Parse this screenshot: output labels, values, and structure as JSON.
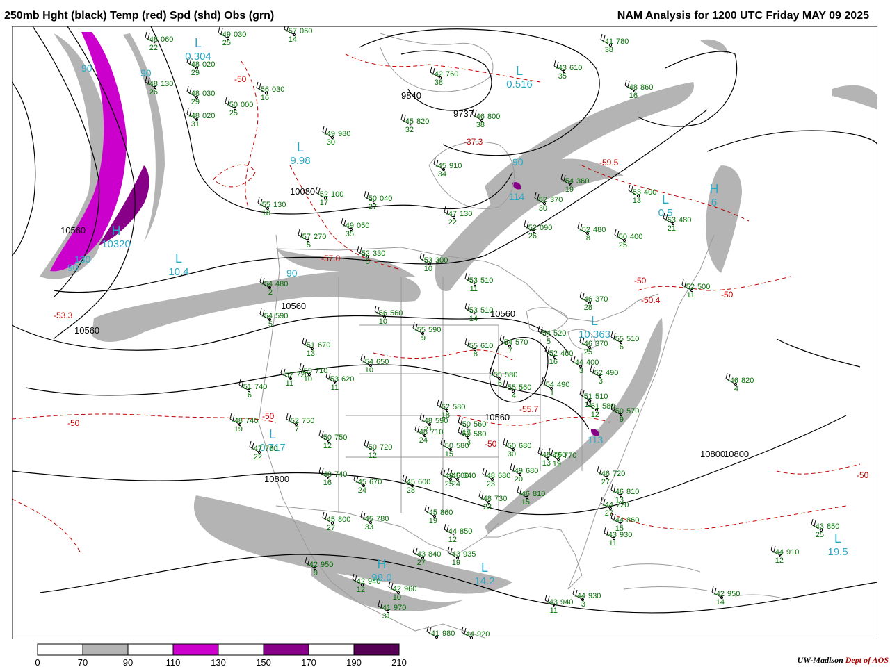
{
  "header": {
    "left": "250mb Hght (black) Temp (red) Spd (shd) Obs (grn)",
    "right": "NAM Analysis for 1200 UTC Friday  MAY 09 2025"
  },
  "colors": {
    "height_contour": "#000000",
    "temp_contour": "#c00000",
    "obs": "#007000",
    "center_label": "#2aa9c6",
    "border": "#9a9a9a",
    "speed_70_90": "#b4b4b4",
    "speed_110_130": "#cc00cc",
    "speed_150_170": "#880088",
    "speed_190_210": "#550055"
  },
  "legend": {
    "ticks": [
      "0",
      "70",
      "90",
      "110",
      "130",
      "150",
      "170",
      "190",
      "210"
    ],
    "bins": [
      {
        "from": 0,
        "to": 70,
        "color": "#ffffff"
      },
      {
        "from": 70,
        "to": 90,
        "color": "#b4b4b4"
      },
      {
        "from": 90,
        "to": 110,
        "color": "#ffffff"
      },
      {
        "from": 110,
        "to": 130,
        "color": "#cc00cc"
      },
      {
        "from": 130,
        "to": 150,
        "color": "#ffffff"
      },
      {
        "from": 150,
        "to": 170,
        "color": "#880088"
      },
      {
        "from": 170,
        "to": 190,
        "color": "#ffffff"
      },
      {
        "from": 190,
        "to": 210,
        "color": "#550055"
      }
    ]
  },
  "credit": {
    "org": "UW-Madison",
    "dept": "Dept of AOS"
  },
  "height_labels": [
    "9840",
    "9737",
    "10080",
    "10560",
    "10560",
    "10560",
    "10560",
    "10560",
    "10800",
    "10800",
    "10800"
  ],
  "centers": [
    {
      "type": "L",
      "value": "0.304"
    },
    {
      "type": "L",
      "value": "0.516"
    },
    {
      "type": "L",
      "value": "9.98"
    },
    {
      "type": "L",
      "value": "10.4"
    },
    {
      "type": "H",
      "value": "10320"
    },
    {
      "type": "L",
      "value": "0.717"
    },
    {
      "type": "H",
      "value": "98.0"
    },
    {
      "type": "L",
      "value": "14.2"
    },
    {
      "type": "L",
      "value": "10.363"
    },
    {
      "type": "L",
      "value": "19.5"
    },
    {
      "type": "H",
      "value": "6"
    },
    {
      "type": "L",
      "value": "0.5"
    }
  ],
  "temp_labels": [
    "-50",
    "-50",
    "-50",
    "-50",
    "-50",
    "-50",
    "-53.3",
    "-57.0",
    "-59.5",
    "-37.3",
    "-55.7",
    "-50",
    "-50.4"
  ],
  "speed_labels": [
    "90",
    "90",
    "90",
    "130",
    "90",
    "90",
    "114",
    "113"
  ],
  "obs": [
    {
      "t": "-48",
      "h": "060",
      "d": "22"
    },
    {
      "t": "-49",
      "h": "030",
      "d": "25"
    },
    {
      "t": "-57",
      "h": "060",
      "d": "14"
    },
    {
      "t": "-48",
      "h": "020",
      "d": "29"
    },
    {
      "t": "-48",
      "h": "130",
      "d": "26"
    },
    {
      "t": "-48",
      "h": "030",
      "d": "29"
    },
    {
      "t": "-56",
      "h": "030",
      "d": "16"
    },
    {
      "t": "-50",
      "h": "000",
      "d": "25"
    },
    {
      "t": "-48",
      "h": "020",
      "d": "31"
    },
    {
      "t": "-49",
      "h": "980",
      "d": "30"
    },
    {
      "t": "-42",
      "h": "760",
      "d": "38"
    },
    {
      "t": "-45",
      "h": "820",
      "d": "32"
    },
    {
      "t": "-46",
      "h": "800",
      "d": "38"
    },
    {
      "t": "-41",
      "h": "780",
      "d": "38"
    },
    {
      "t": "-43",
      "h": "610",
      "d": "35"
    },
    {
      "t": "-48",
      "h": "860",
      "d": "16"
    },
    {
      "t": "-45",
      "h": "910",
      "d": "34"
    },
    {
      "t": "-52",
      "h": "100",
      "d": "17"
    },
    {
      "t": "-50",
      "h": "040",
      "d": "27"
    },
    {
      "t": "-49",
      "h": "050",
      "d": "35"
    },
    {
      "t": "-55",
      "h": "130",
      "d": "18"
    },
    {
      "t": "-52",
      "h": "090",
      "d": "26"
    },
    {
      "t": "-47",
      "h": "130",
      "d": "22"
    },
    {
      "t": "-52",
      "h": "370",
      "d": "30"
    },
    {
      "t": "-54",
      "h": "360",
      "d": "19"
    },
    {
      "t": "-53",
      "h": "400",
      "d": "13"
    },
    {
      "t": "-52",
      "h": "480",
      "d": "8"
    },
    {
      "t": "-57",
      "h": "270",
      "d": "5"
    },
    {
      "t": "-50",
      "h": "400",
      "d": "25"
    },
    {
      "t": "-53",
      "h": "480",
      "d": "21"
    },
    {
      "t": "-52",
      "h": "330",
      "d": "5"
    },
    {
      "t": "-53",
      "h": "300",
      "d": "10"
    },
    {
      "t": "-54",
      "h": "480",
      "d": "2"
    },
    {
      "t": "-53",
      "h": "510",
      "d": "11"
    },
    {
      "t": "-52",
      "h": "500",
      "d": "11"
    },
    {
      "t": "-46",
      "h": "370",
      "d": "28"
    },
    {
      "t": "-54",
      "h": "590",
      "d": "5"
    },
    {
      "t": "-56",
      "h": "560",
      "d": "10"
    },
    {
      "t": "-53",
      "h": "510",
      "d": "14"
    },
    {
      "t": "-55",
      "h": "590",
      "d": "9"
    },
    {
      "t": "-51",
      "h": "670",
      "d": "13"
    },
    {
      "t": "-55",
      "h": "610",
      "d": "8"
    },
    {
      "t": "-54",
      "h": "570",
      "d": "7"
    },
    {
      "t": "-54",
      "h": "520",
      "d": "5"
    },
    {
      "t": "-52",
      "h": "460",
      "d": "16"
    },
    {
      "t": "-46",
      "h": "370",
      "d": "25"
    },
    {
      "t": "-55",
      "h": "510",
      "d": "6"
    },
    {
      "t": "-54",
      "h": "650",
      "d": "10"
    },
    {
      "t": "-52",
      "h": "720",
      "d": "11"
    },
    {
      "t": "-55",
      "h": "710",
      "d": "10"
    },
    {
      "t": "-53",
      "h": "620",
      "d": "11"
    },
    {
      "t": "-55",
      "h": "580",
      "d": "6"
    },
    {
      "t": "-44",
      "h": "400",
      "d": "3"
    },
    {
      "t": "-52",
      "h": "490",
      "d": "3"
    },
    {
      "t": "-46",
      "h": "820",
      "d": "4"
    },
    {
      "t": "-51",
      "h": "740",
      "d": "6"
    },
    {
      "t": "-55",
      "h": "560",
      "d": "4"
    },
    {
      "t": "-54",
      "h": "490",
      "d": "1"
    },
    {
      "t": "-51",
      "h": "510",
      "d": "11"
    },
    {
      "t": "-51",
      "h": "580",
      "d": "12"
    },
    {
      "t": "-50",
      "h": "570",
      "d": "9"
    },
    {
      "t": "-48",
      "h": "740",
      "d": "19"
    },
    {
      "t": "-52",
      "h": "750",
      "d": "7"
    },
    {
      "t": "-52",
      "h": "580",
      "d": "18"
    },
    {
      "t": "-48",
      "h": "590",
      "d": "21"
    },
    {
      "t": "-50",
      "h": "560",
      "d": "17"
    },
    {
      "t": "-50",
      "h": "580",
      "d": "3"
    },
    {
      "t": "-48",
      "h": "710",
      "d": "24"
    },
    {
      "t": "-47",
      "h": "760",
      "d": "22"
    },
    {
      "t": "-50",
      "h": "750",
      "d": "12"
    },
    {
      "t": "-50",
      "h": "720",
      "d": "12"
    },
    {
      "t": "-50",
      "h": "580",
      "d": "15"
    },
    {
      "t": "-48",
      "h": "600",
      "d": "25"
    },
    {
      "t": "-50",
      "h": "680",
      "d": "30"
    },
    {
      "t": "-48",
      "h": "770",
      "d": "19"
    },
    {
      "t": "-48",
      "h": "740",
      "d": "16"
    },
    {
      "t": "-45",
      "h": "670",
      "d": "24"
    },
    {
      "t": "-45",
      "h": "600",
      "d": "28"
    },
    {
      "t": "-45",
      "h": "640",
      "d": "24"
    },
    {
      "t": "-48",
      "h": "680",
      "d": "23"
    },
    {
      "t": "-49",
      "h": "680",
      "d": "20"
    },
    {
      "t": "-48",
      "h": "760",
      "d": "13"
    },
    {
      "t": "-46",
      "h": "720",
      "d": "27"
    },
    {
      "t": "-48",
      "h": "730",
      "d": "23"
    },
    {
      "t": "-46",
      "h": "810",
      "d": "15"
    },
    {
      "t": "-46",
      "h": "810",
      "d": "13"
    },
    {
      "t": "-44",
      "h": "720",
      "d": "27"
    },
    {
      "t": "-45",
      "h": "860",
      "d": "19"
    },
    {
      "t": "-45",
      "h": "800",
      "d": "27"
    },
    {
      "t": "-45",
      "h": "780",
      "d": "33"
    },
    {
      "t": "-44",
      "h": "850",
      "d": "12"
    },
    {
      "t": "-44",
      "h": "860",
      "d": "15"
    },
    {
      "t": "-43",
      "h": "930",
      "d": "11"
    },
    {
      "t": "-43",
      "h": "850",
      "d": "25"
    },
    {
      "t": "-43",
      "h": "840",
      "d": "27"
    },
    {
      "t": "-43",
      "h": "935",
      "d": "19"
    },
    {
      "t": "-42",
      "h": "950",
      "d": "9"
    },
    {
      "t": "-42",
      "h": "940",
      "d": "12"
    },
    {
      "t": "-44",
      "h": "910",
      "d": "12"
    },
    {
      "t": "-42",
      "h": "960",
      "d": "10"
    },
    {
      "t": "-41",
      "h": "970",
      "d": "31"
    },
    {
      "t": "-41",
      "h": "980",
      "d": "29"
    },
    {
      "t": "-44",
      "h": "920",
      "d": "8"
    },
    {
      "t": "-44",
      "h": "930",
      "d": "3"
    },
    {
      "t": "-43",
      "h": "940",
      "d": "11"
    },
    {
      "t": "-42",
      "h": "950",
      "d": "14"
    }
  ]
}
